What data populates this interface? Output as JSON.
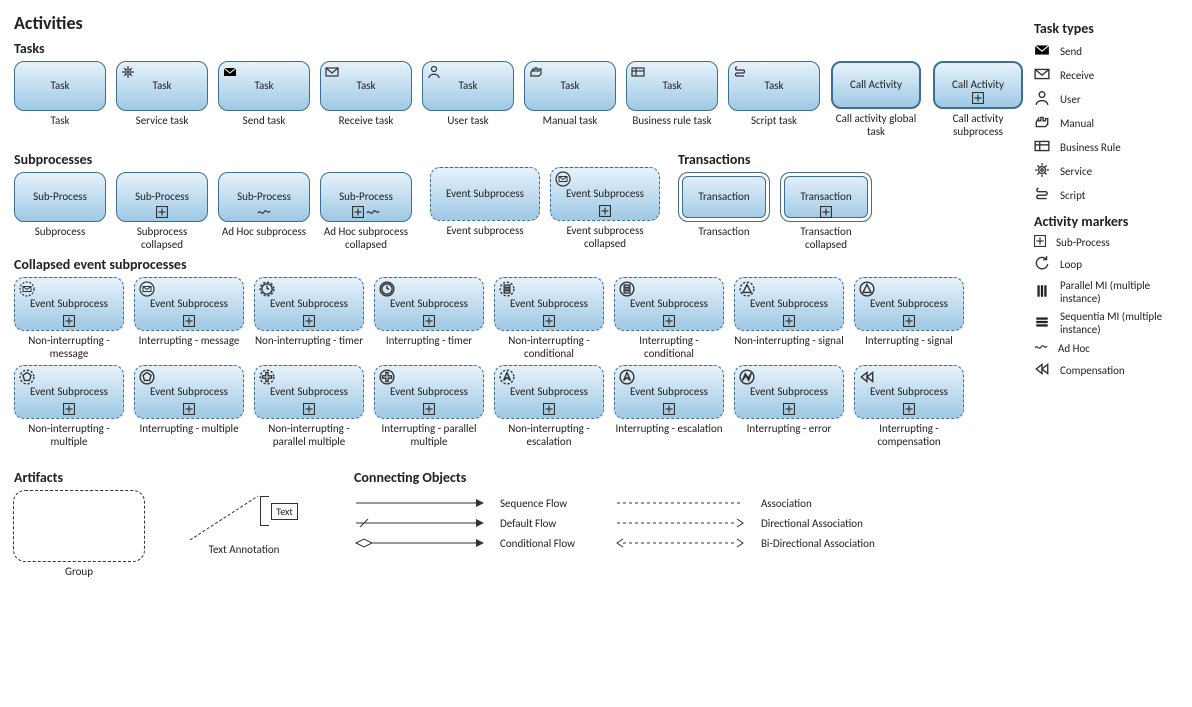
{
  "titles": {
    "activities": "Activities",
    "tasks": "Tasks",
    "subprocesses": "Subprocesses",
    "transactions": "Transactions",
    "collapsed": "Collapsed event subprocesses",
    "artifacts": "Artifacts",
    "connecting": "Connecting Objects",
    "taskTypes": "Task types",
    "activityMarkers": "Activity markers"
  },
  "tasks": [
    {
      "label": "Task",
      "caption": "Task",
      "icon": null
    },
    {
      "label": "Task",
      "caption": "Service task",
      "icon": "service"
    },
    {
      "label": "Task",
      "caption": "Send task",
      "icon": "send"
    },
    {
      "label": "Task",
      "caption": "Receive task",
      "icon": "receive"
    },
    {
      "label": "Task",
      "caption": "User task",
      "icon": "user"
    },
    {
      "label": "Task",
      "caption": "Manual task",
      "icon": "manual"
    },
    {
      "label": "Task",
      "caption": "Business rule task",
      "icon": "rule"
    },
    {
      "label": "Task",
      "caption": "Script task",
      "icon": "script"
    },
    {
      "label": "Call Activity",
      "caption": "Call activity global task",
      "icon": null,
      "thick": true
    },
    {
      "label": "Call Activity",
      "caption": "Call activity subprocess",
      "icon": null,
      "thick": true,
      "marker": "plus"
    }
  ],
  "subprocesses": [
    {
      "label": "Sub-Process",
      "caption": "Subprocess"
    },
    {
      "label": "Sub-Process",
      "caption": "Subprocess collapsed",
      "marker": "plus"
    },
    {
      "label": "Sub-Process",
      "caption": "Ad Hoc subprocess",
      "marker": "tilde"
    },
    {
      "label": "Sub-Process",
      "caption": "Ad Hoc subprocess collapsed",
      "marker": "plus-tilde"
    }
  ],
  "eventSub": [
    {
      "label": "Event Subprocess",
      "caption": "Event subprocess"
    },
    {
      "label": "Event Subprocess",
      "caption": "Event subprocess collapsed",
      "icon": "receive",
      "marker": "plus"
    }
  ],
  "transactions": [
    {
      "label": "Transaction",
      "caption": "Transaction"
    },
    {
      "label": "Transaction",
      "caption": "Transaction collapsed",
      "marker": "plus"
    }
  ],
  "collapsedRows": [
    [
      {
        "caption": "Non-interrupting - message",
        "icon": "receive",
        "ni": true
      },
      {
        "caption": "Interrupting - message",
        "icon": "receive"
      },
      {
        "caption": "Non-interrupting - timer",
        "icon": "timer",
        "ni": true
      },
      {
        "caption": "Interrupting - timer",
        "icon": "timer"
      },
      {
        "caption": "Non-interrupting - conditional",
        "icon": "cond",
        "ni": true
      },
      {
        "caption": "Interrupting - conditional",
        "icon": "cond"
      },
      {
        "caption": "Non-interrupting - signal",
        "icon": "signal",
        "ni": true
      },
      {
        "caption": "Interrupting - signal",
        "icon": "signal"
      }
    ],
    [
      {
        "caption": "Non-interrupting - multiple",
        "icon": "mult",
        "ni": true
      },
      {
        "caption": "Interrupting - multiple",
        "icon": "mult"
      },
      {
        "caption": "Non-interrupting - parallel multiple",
        "icon": "pmult",
        "ni": true
      },
      {
        "caption": "Interrupting - parallel multiple",
        "icon": "pmult"
      },
      {
        "caption": "Non-interrupting - escalation",
        "icon": "esc",
        "ni": true
      },
      {
        "caption": "Interrupting - escalation",
        "icon": "esc"
      },
      {
        "caption": "Interrupting - error",
        "icon": "error"
      },
      {
        "caption": "Interrupting - compensation",
        "icon": "comp"
      }
    ]
  ],
  "collapsedLabel": "Event Subprocess",
  "artifacts": {
    "group": "Group",
    "textAnn": "Text Annotation",
    "text": "Text"
  },
  "flows": [
    {
      "name": "Sequence Flow",
      "style": "seq"
    },
    {
      "name": "Default Flow",
      "style": "def"
    },
    {
      "name": "Conditional Flow",
      "style": "cond"
    }
  ],
  "assoc": [
    {
      "name": "Association",
      "style": "assoc"
    },
    {
      "name": "Directional Association",
      "style": "dassoc"
    },
    {
      "name": "Bi-Directional Association",
      "style": "bassoc"
    }
  ],
  "taskTypes": [
    {
      "icon": "send",
      "label": "Send"
    },
    {
      "icon": "receive",
      "label": "Receive"
    },
    {
      "icon": "user",
      "label": "User"
    },
    {
      "icon": "manual",
      "label": "Manual"
    },
    {
      "icon": "rule",
      "label": "Business Rule"
    },
    {
      "icon": "service",
      "label": "Service"
    },
    {
      "icon": "script",
      "label": "Script"
    }
  ],
  "activityMarkers": [
    {
      "icon": "plus",
      "label": "Sub-Process"
    },
    {
      "icon": "loop",
      "label": "Loop"
    },
    {
      "icon": "pmi",
      "label": "Parallel MI (multiple instance)"
    },
    {
      "icon": "smi",
      "label": "Sequentia MI (multiple instance)"
    },
    {
      "icon": "tilde",
      "label": "Ad Hoc"
    },
    {
      "icon": "comp",
      "label": "Compensation"
    }
  ]
}
